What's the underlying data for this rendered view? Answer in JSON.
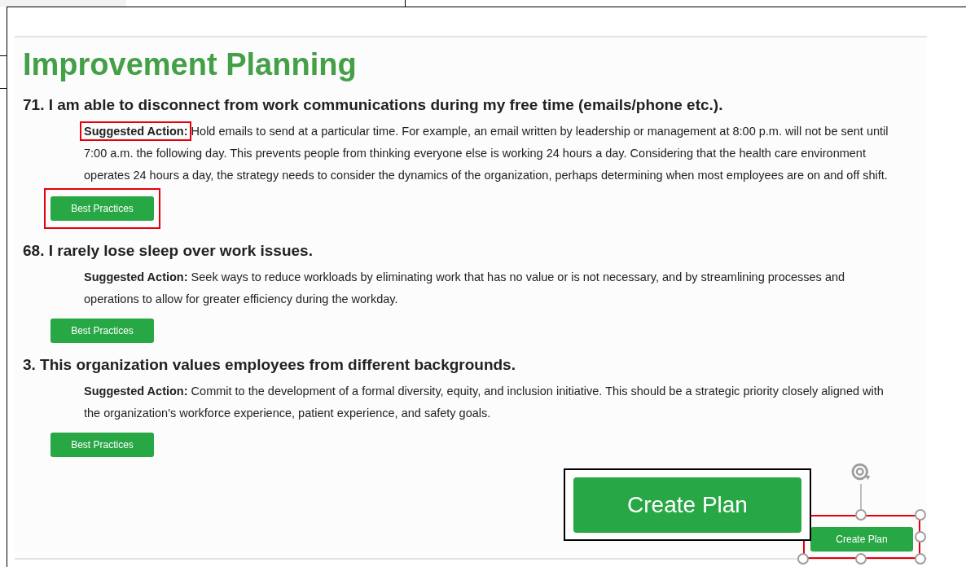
{
  "title": "Improvement Planning",
  "items": [
    {
      "question": "71. I am able to disconnect from work communications during my free time (emails/phone etc.).",
      "action": "**Suggested Action:** Hold emails to send at a particular time. For example, an email written by leadership or management at 8:00 p.m. will not be sent until 7:00 a.m. the following day. This prevents people from thinking everyone else is working 24 hours a day. Considering that the health care environment operates 24 hours a day, the strategy needs to consider the dynamics of the organization, perhaps determining when most employees are on and off shift.",
      "button": "Best Practices",
      "highlighted": true
    },
    {
      "question": "68. I rarely lose sleep over work issues.",
      "action": "**Suggested Action:** Seek ways to reduce workloads by eliminating work that has no value or is not necessary, and by streamlining processes and operations to allow for greater efficiency during the workday.",
      "button": "Best Practices",
      "highlighted": false
    },
    {
      "question": "3. This organization values employees from different backgrounds.",
      "action": "**Suggested Action:** Commit to the development of a formal diversity, equity, and inclusion initiative. This should be a strategic priority closely aligned with the organization's workforce experience, patient experience, and safety goals.",
      "button": "Best Practices",
      "highlighted": false
    }
  ],
  "create_plan": {
    "label": "Create Plan",
    "selected": true
  },
  "callout": {
    "label": "Create Plan"
  }
}
